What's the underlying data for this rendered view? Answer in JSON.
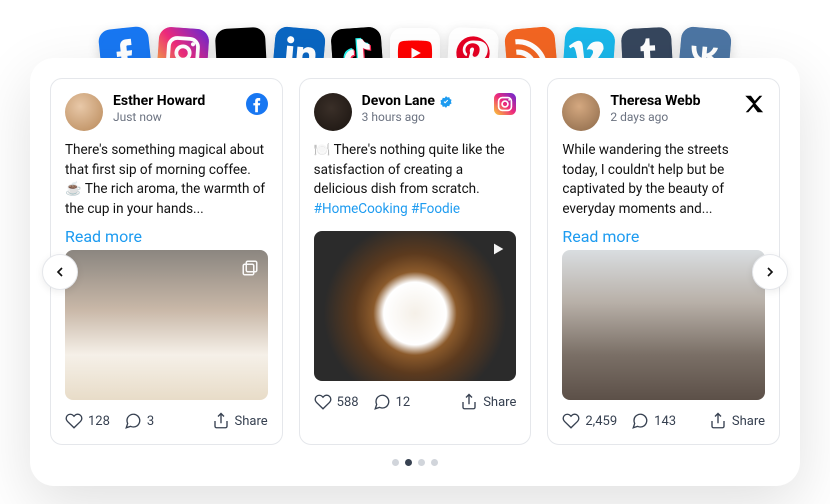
{
  "social_icons": [
    {
      "name": "facebook",
      "bg": "#1877f2",
      "rot": -6
    },
    {
      "name": "instagram",
      "bg": "linear-gradient(45deg,#f9ce34,#ee2a7b,#6228d7)",
      "rot": 4
    },
    {
      "name": "x",
      "bg": "#000",
      "rot": -3
    },
    {
      "name": "linkedin",
      "bg": "#0a66c2",
      "rot": 5
    },
    {
      "name": "tiktok",
      "bg": "#000",
      "rot": -4
    },
    {
      "name": "youtube",
      "bg": "#fff",
      "rot": 0
    },
    {
      "name": "pinterest",
      "bg": "#fff",
      "rot": 3
    },
    {
      "name": "rss",
      "bg": "#f26522",
      "rot": -5
    },
    {
      "name": "vimeo",
      "bg": "#1ab7ea",
      "rot": 4
    },
    {
      "name": "tumblr",
      "bg": "#36465d",
      "rot": -3
    },
    {
      "name": "vk",
      "bg": "#4c75a3",
      "rot": 5
    }
  ],
  "cards": [
    {
      "name": "Esther Howard",
      "verified": false,
      "time": "Just now",
      "platform": "facebook",
      "body": "There's something magical about that first sip of morning coffee. ☕ The rich aroma, the warmth of the cup in your hands...",
      "hashtags": "",
      "read_more": "Read more",
      "likes": "128",
      "comments": "3",
      "share": "Share",
      "overlay": "carousel",
      "image": {
        "bg": "linear-gradient(180deg,#8b8680 0%,#c9b8a8 40%,#f5f0e8 70%,#e8dcc8 100%)"
      }
    },
    {
      "name": "Devon Lane",
      "verified": true,
      "time": "3 hours ago",
      "platform": "instagram",
      "body": "🍽️ There's nothing quite like the satisfaction of creating a delicious dish from scratch.",
      "hashtags": "#HomeCooking #Foodie",
      "read_more": "",
      "likes": "588",
      "comments": "12",
      "share": "Share",
      "overlay": "video",
      "image": {
        "bg": "radial-gradient(circle at 50% 55%,#f5f0e8 0%,#fff 24%,#8b5a2b 32%,#5c3a1e 46%,#2b2b2b 70%)"
      }
    },
    {
      "name": "Theresa Webb",
      "verified": false,
      "time": "2 days ago",
      "platform": "x",
      "body": "While wandering the streets today, I couldn't help but be captivated by the beauty of everyday moments and...",
      "hashtags": "",
      "read_more": "Read more",
      "likes": "2,459",
      "comments": "143",
      "share": "Share",
      "overlay": "",
      "image": {
        "bg": "linear-gradient(180deg,#d9dde0 0%,#b8b0a8 35%,#7a6f66 70%,#5c5048 100%)"
      }
    }
  ],
  "pagination": {
    "total": 4,
    "active": 1
  },
  "avatars": [
    {
      "bg": "radial-gradient(circle at 40% 35%,#e8c8a8,#b88858)"
    },
    {
      "bg": "radial-gradient(circle at 45% 40%,#3a2f28,#1a1410)"
    },
    {
      "bg": "radial-gradient(circle at 45% 35%,#d4a880,#8b6848)"
    }
  ]
}
